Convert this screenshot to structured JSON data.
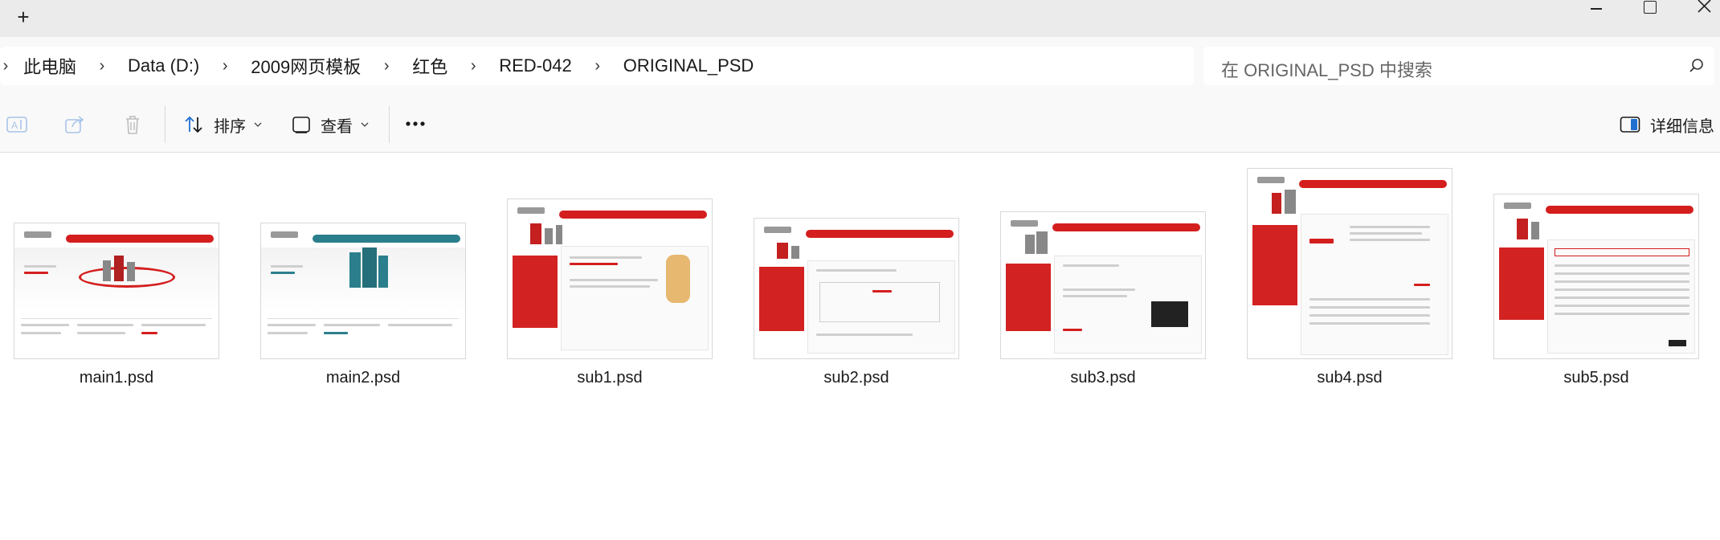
{
  "titlebar": {
    "new_tab_glyph": "+",
    "controls": [
      "minimize",
      "maximize",
      "close"
    ]
  },
  "breadcrumb": {
    "items": [
      "此电脑",
      "Data (D:)",
      "2009网页模板",
      "红色",
      "RED-042",
      "ORIGINAL_PSD"
    ],
    "separator_glyph": "›"
  },
  "search": {
    "placeholder": "在 ORIGINAL_PSD 中搜索"
  },
  "toolbar": {
    "sort_label": "排序",
    "view_label": "查看",
    "more_glyph": "•••",
    "details_label": "详细信息"
  },
  "files": [
    {
      "name": "main1.psd",
      "theme": "#d41e1e"
    },
    {
      "name": "main2.psd",
      "theme": "#2b7f8c"
    },
    {
      "name": "sub1.psd",
      "theme": "#d41e1e"
    },
    {
      "name": "sub2.psd",
      "theme": "#d41e1e"
    },
    {
      "name": "sub3.psd",
      "theme": "#d41e1e"
    },
    {
      "name": "sub4.psd",
      "theme": "#d41e1e"
    },
    {
      "name": "sub5.psd",
      "theme": "#d41e1e"
    }
  ],
  "colors": {
    "titlebar_bg": "#ebebeb",
    "toolbar_bg": "#f9f9f9",
    "accent_red": "#d41e1e",
    "accent_teal": "#2b7f8c",
    "details_icon": "#1f6fd1"
  }
}
